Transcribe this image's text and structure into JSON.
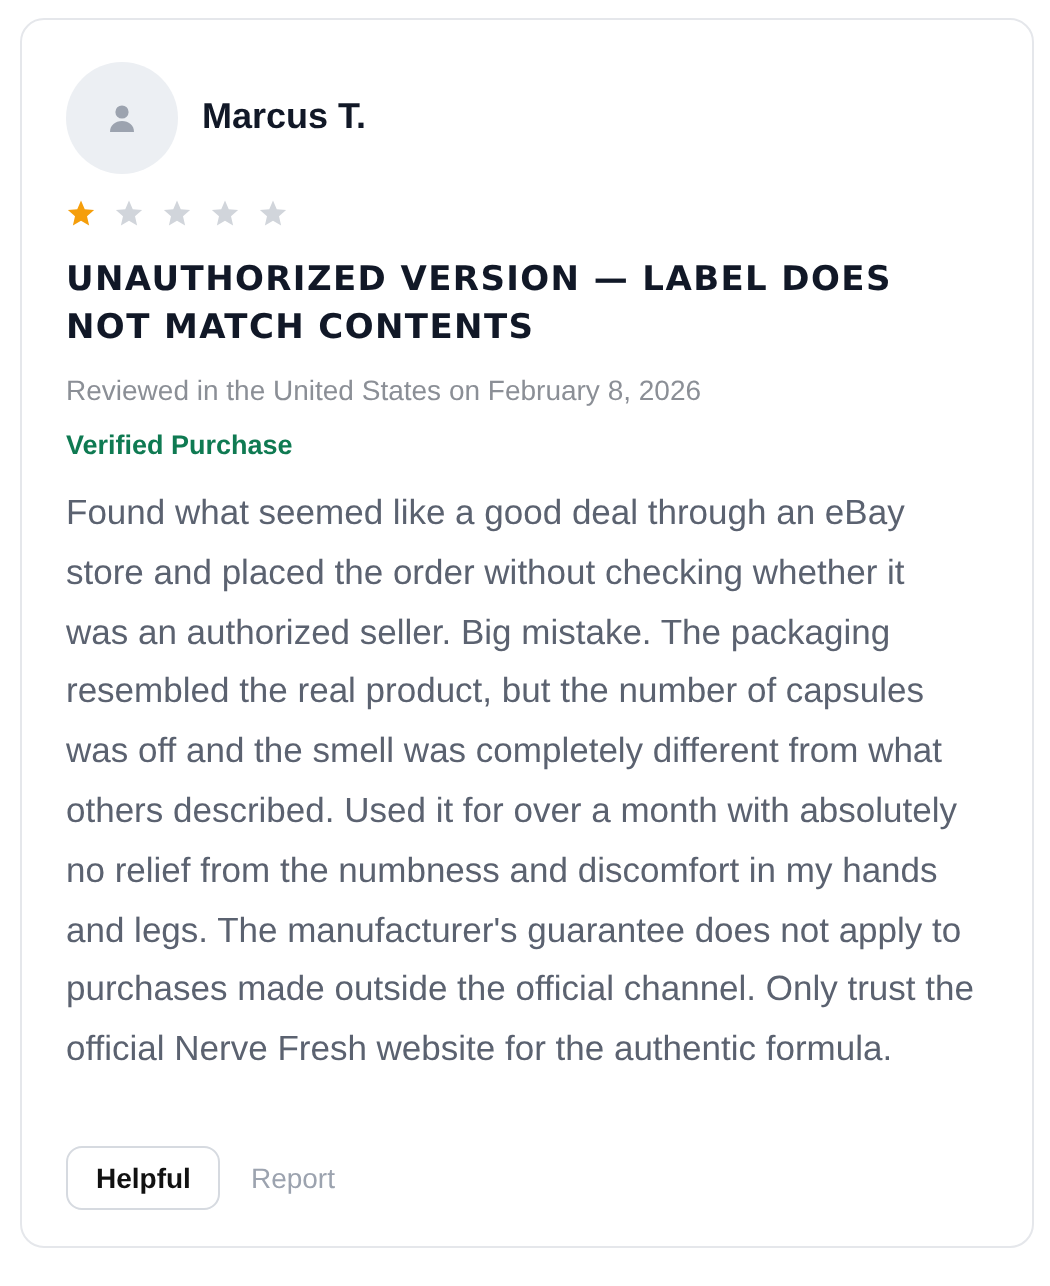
{
  "review": {
    "author": "Marcus T.",
    "stars": 1,
    "title": "UNAUTHORIZED VERSION — LABEL DOES NOT MATCH CONTENTS",
    "date": "Reviewed in the United States on February 8, 2026",
    "verified": "Verified Purchase",
    "body": "Found what seemed like a good deal through an eBay store and placed the order without checking whether it was an authorized seller. Big mistake. The packaging resembled the real product, but the number of capsules was off and the smell was completely different from what others described. Used it for over a month with absolutely no relief from the numbness and discomfort in my hands and legs. The manufacturer's guarantee does not apply to purchases made outside the official channel. Only trust the official Nerve Fresh website for the authentic formula.",
    "actions": [
      {
        "kind": "button",
        "label": "Helpful"
      },
      {
        "kind": "link",
        "label": "Report"
      }
    ]
  }
}
